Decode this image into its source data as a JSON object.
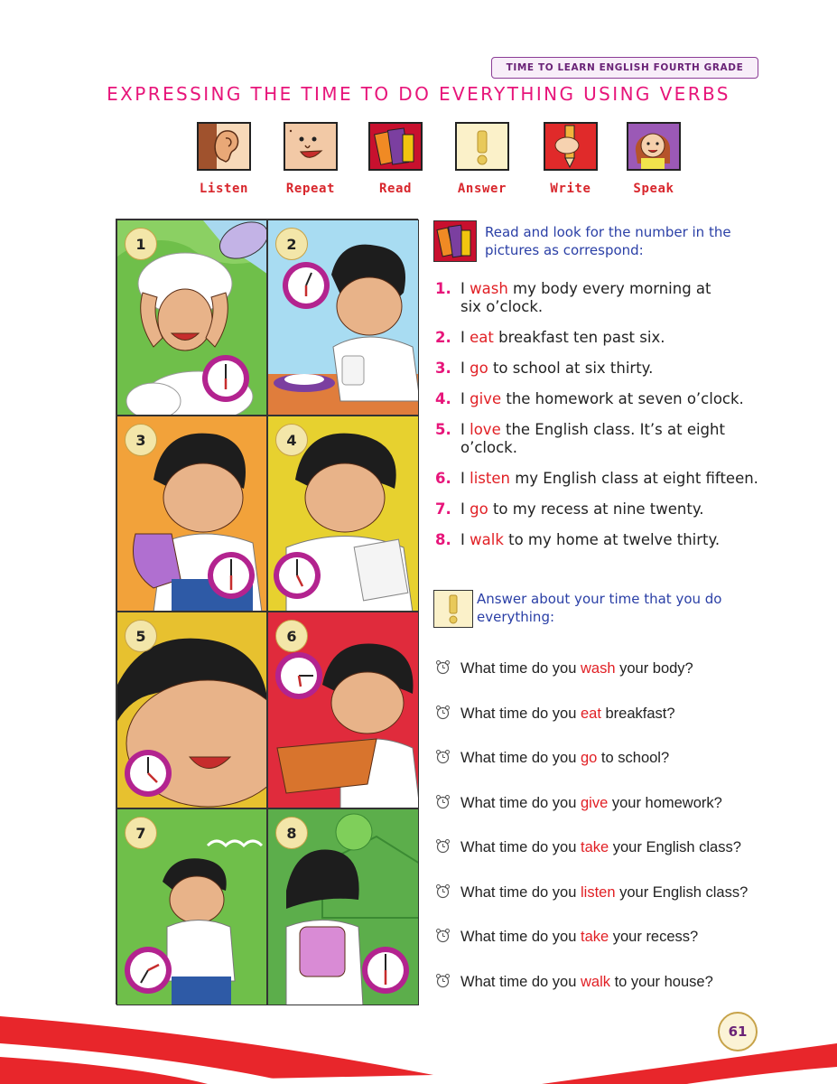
{
  "header": {
    "book_title": "TIME TO LEARN ENGLISH FOURTH GRADE",
    "page_title": "EXPRESSING THE TIME TO DO EVERYTHING USING VERBS"
  },
  "activity_icons": [
    {
      "label": "Listen",
      "icon": "ear-icon"
    },
    {
      "label": "Repeat",
      "icon": "talking-face-icon"
    },
    {
      "label": "Read",
      "icon": "books-icon"
    },
    {
      "label": "Answer",
      "icon": "exclamation-icon"
    },
    {
      "label": "Write",
      "icon": "pencil-hand-icon"
    },
    {
      "label": "Speak",
      "icon": "girl-speaking-icon"
    }
  ],
  "panels": [
    {
      "number": "1",
      "clock_time": "6:00"
    },
    {
      "number": "2",
      "clock_time": "6:10"
    },
    {
      "number": "3",
      "clock_time": "6:30"
    },
    {
      "number": "4",
      "clock_time": "7:00"
    },
    {
      "number": "5",
      "clock_time": "8:00"
    },
    {
      "number": "6",
      "clock_time": "8:15"
    },
    {
      "number": "7",
      "clock_time": "9:20"
    },
    {
      "number": "8",
      "clock_time": "12:30"
    }
  ],
  "read_section": {
    "instruction": "Read and look for the number in the pictures as correspond:",
    "sentences": [
      {
        "num": "1.",
        "pre": "I ",
        "verb": "wash",
        "post": " my body every morning at six o’clock."
      },
      {
        "num": "2.",
        "pre": "I ",
        "verb": "eat",
        "post": " breakfast ten past six."
      },
      {
        "num": "3.",
        "pre": "I ",
        "verb": "go",
        "post": " to school at six thirty."
      },
      {
        "num": "4.",
        "pre": "I ",
        "verb": "give",
        "post": " the homework at seven o’clock."
      },
      {
        "num": "5.",
        "pre": "I ",
        "verb": "love",
        "post": " the English class. It’s at eight o’clock."
      },
      {
        "num": "6.",
        "pre": "I ",
        "verb": "listen",
        "post": " my English class at eight fifteen."
      },
      {
        "num": "7.",
        "pre": "I ",
        "verb": "go",
        "post": " to my recess at nine twenty."
      },
      {
        "num": "8.",
        "pre": "I ",
        "verb": "walk",
        "post": " to my home at twelve thirty."
      }
    ]
  },
  "answer_section": {
    "instruction": "Answer about your time that you do everything:",
    "questions": [
      {
        "pre": "What time do you ",
        "verb": "wash",
        "post": " your body?"
      },
      {
        "pre": "What time do you ",
        "verb": "eat",
        "post": " breakfast?"
      },
      {
        "pre": "What time do you ",
        "verb": "go",
        "post": " to school?"
      },
      {
        "pre": "What time do you ",
        "verb": "give",
        "post": " your homework?"
      },
      {
        "pre": "What time do you ",
        "verb": "take",
        "post": " your English class?"
      },
      {
        "pre": "What time do you ",
        "verb": "listen",
        "post": " your English class?"
      },
      {
        "pre": "What time do you ",
        "verb": "take",
        "post": " your recess?"
      },
      {
        "pre": "What time do you ",
        "verb": "walk",
        "post": " to your house?"
      }
    ]
  },
  "footer": {
    "page_number": "61"
  },
  "colors": {
    "title_pink": "#e7157a",
    "verb_red": "#e11f24",
    "instruction_blue": "#2a3fa6",
    "clock_magenta": "#b3238f",
    "wave_red": "#e8262b"
  }
}
